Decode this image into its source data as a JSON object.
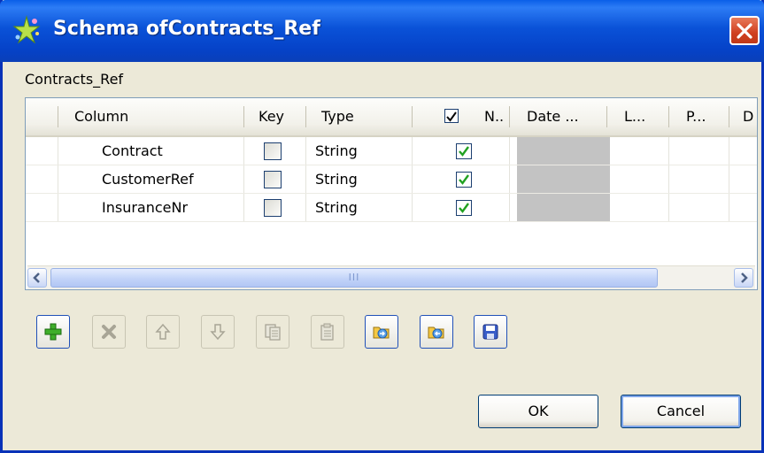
{
  "window": {
    "title": "Schema ofContracts_Ref",
    "icon": "star-sparkle-icon",
    "close_icon": "close-icon"
  },
  "schema_label": "Contracts_Ref",
  "table": {
    "headers": {
      "column": "Column",
      "key": "Key",
      "type": "Type",
      "nullable": "N..",
      "date_pattern": "Date ...",
      "length": "L...",
      "precision": "P...",
      "default": "D"
    },
    "rows": [
      {
        "column": "Contract",
        "key": false,
        "type": "String",
        "nullable": true
      },
      {
        "column": "CustomerRef",
        "key": false,
        "type": "String",
        "nullable": true
      },
      {
        "column": "InsuranceNr",
        "key": false,
        "type": "String",
        "nullable": true
      }
    ],
    "scrollbar_grip": "III"
  },
  "toolbar": {
    "buttons": [
      {
        "name": "add-row-button",
        "icon": "plus-icon",
        "enabled": true
      },
      {
        "name": "delete-row-button",
        "icon": "x-icon",
        "enabled": false
      },
      {
        "name": "move-up-button",
        "icon": "arrow-up-icon",
        "enabled": false
      },
      {
        "name": "move-down-button",
        "icon": "arrow-down-icon",
        "enabled": false
      },
      {
        "name": "copy-button",
        "icon": "copy-icon",
        "enabled": false
      },
      {
        "name": "paste-button",
        "icon": "paste-icon",
        "enabled": false
      },
      {
        "name": "import-schema-button",
        "icon": "import-icon",
        "enabled": true
      },
      {
        "name": "export-schema-button",
        "icon": "export-icon",
        "enabled": true
      },
      {
        "name": "save-schema-button",
        "icon": "floppy-disk-icon",
        "enabled": true
      }
    ]
  },
  "buttons": {
    "ok": "OK",
    "cancel": "Cancel"
  },
  "colors": {
    "titlebar": "#0a52d8",
    "dialog_bg": "#ece9d8",
    "check_green": "#21a121",
    "gray_cell": "#c3c3c3"
  }
}
